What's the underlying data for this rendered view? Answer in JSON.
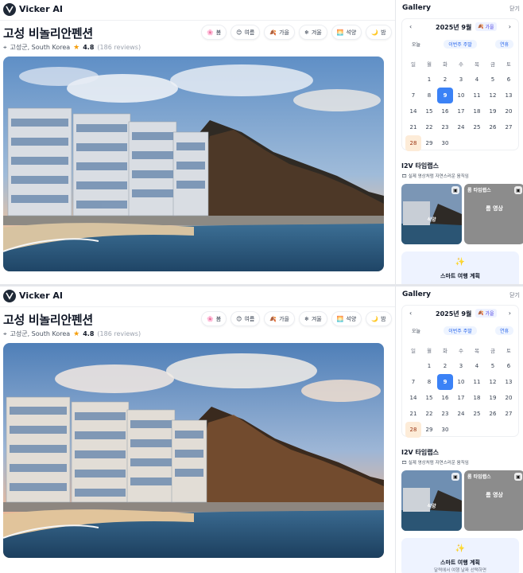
{
  "app": {
    "brand": "Vicker AI"
  },
  "property": {
    "title": "고성 비놀리안펜션",
    "location": "고성군, South Korea",
    "rating": "4.8",
    "reviews": "(186 reviews)"
  },
  "seasons": [
    {
      "icon": "🌸",
      "label": "봄"
    },
    {
      "icon": "😊",
      "label": "여름"
    },
    {
      "icon": "🍂",
      "label": "가을"
    },
    {
      "icon": "❄",
      "label": "겨울"
    },
    {
      "icon": "🌅",
      "label": "석양"
    },
    {
      "icon": "🌙",
      "label": "밤"
    }
  ],
  "gallery": {
    "title": "Gallery",
    "close": "닫기",
    "calendar": {
      "month": "2025년 9월",
      "season_badge": "가을",
      "quick": [
        "오늘",
        "이번주 주말",
        "연휴"
      ],
      "weekdays": [
        "일",
        "월",
        "화",
        "수",
        "목",
        "금",
        "토"
      ],
      "weeks": [
        [
          "",
          "1",
          "2",
          "3",
          "4",
          "5",
          "6"
        ],
        [
          "7",
          "8",
          "9",
          "10",
          "11",
          "12",
          "13"
        ],
        [
          "14",
          "15",
          "16",
          "17",
          "18",
          "19",
          "20"
        ],
        [
          "21",
          "22",
          "23",
          "24",
          "25",
          "26",
          "27"
        ],
        [
          "28",
          "29",
          "30",
          "",
          "",
          "",
          ""
        ]
      ],
      "selected": "9",
      "highlight": "28"
    },
    "i2v": {
      "title": "I2V 타임랩스",
      "subtitle": "실제 영상처럼 자연스러운 움직임",
      "subtitle_2": "실제 영상처럼 자연스러운 움직임",
      "thumb1_label": "석양",
      "thumb2_label": "롬 타임랩스",
      "thumb2_sub": "롬 영상"
    },
    "smart": {
      "title": "스마트 여행 계획",
      "subtitle": "달력에서 여행 날짜 선택하면"
    }
  },
  "colors": {
    "accent": "#3b82f6",
    "highlight": "#fdecd8"
  }
}
